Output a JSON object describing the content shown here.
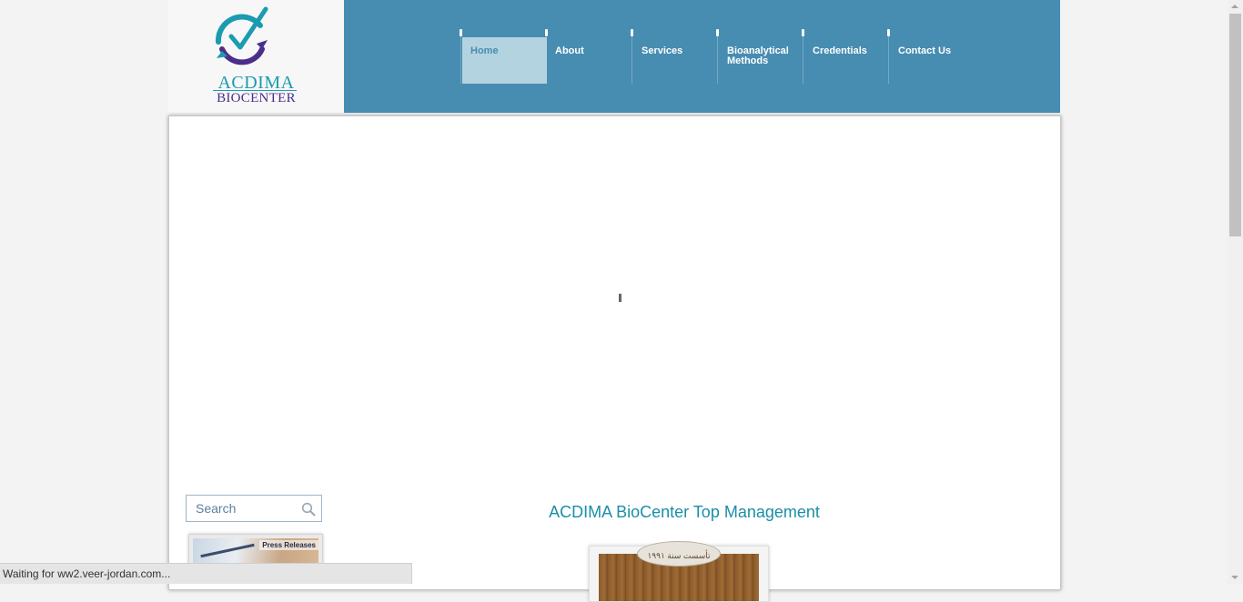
{
  "brand": {
    "name_line1": "ACDIMA",
    "name_line2": "BIOCENTER"
  },
  "nav": [
    {
      "label": "Home",
      "active": true
    },
    {
      "label": "About",
      "active": false
    },
    {
      "label": "Services",
      "active": false
    },
    {
      "label": "Bioanalytical Methods",
      "active": false
    },
    {
      "label": "Credentials",
      "active": false
    },
    {
      "label": "Contact Us",
      "active": false
    }
  ],
  "search": {
    "placeholder": "Search",
    "value": ""
  },
  "press_banner": {
    "label": "Press Releases"
  },
  "section": {
    "title": "ACDIMA BioCenter Top Management"
  },
  "browser": {
    "status_text": "Waiting for ww2.veer-jordan.com..."
  },
  "colors": {
    "header": "#478cb1",
    "active_nav": "#b3d3e0",
    "accent": "#1a8fa8",
    "purple": "#4a2e8a"
  },
  "icons": {
    "search": "magnifier-icon",
    "logo": "checkmark-cycle-icon"
  }
}
